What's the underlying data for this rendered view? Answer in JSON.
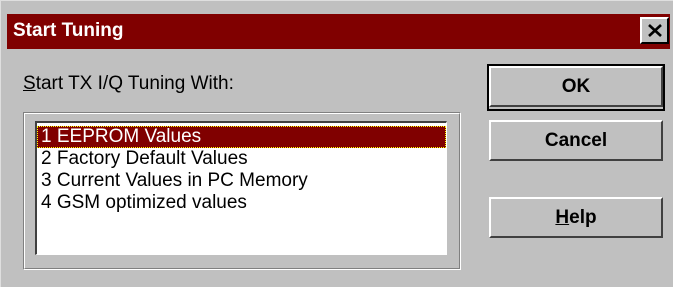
{
  "window": {
    "title": "Start Tuning",
    "close_symbol": "×",
    "titlebar_color": "#800000"
  },
  "prompt": {
    "mnemonic": "S",
    "rest": "tart TX I/Q Tuning With:"
  },
  "list": {
    "items": [
      "1 EEPROM Values",
      "2 Factory Default Values",
      "3 Current Values in PC Memory",
      "4 GSM optimized values"
    ],
    "selected_index": 0,
    "selection_color": "#800000"
  },
  "buttons": {
    "ok": "OK",
    "cancel": "Cancel",
    "help_mnemonic": "H",
    "help_rest": "elp"
  }
}
